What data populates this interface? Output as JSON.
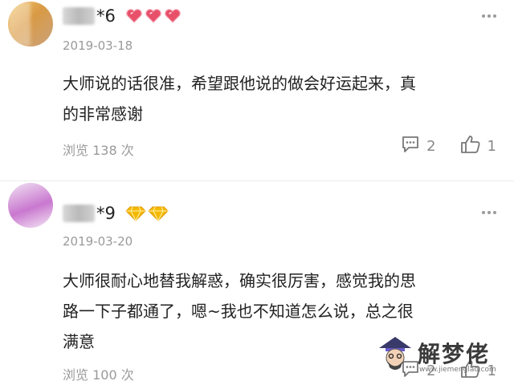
{
  "comments": [
    {
      "name_suffix": "*6",
      "badge_type": "heart",
      "badge_count": 3,
      "date": "2019-03-18",
      "text_line1": "大师说的话很准，希望跟他说的做会好运起来，真",
      "text_line2": "的非常感谢",
      "text_line3": "",
      "views": "浏览 138 次",
      "reply_count": "2",
      "like_count": "1"
    },
    {
      "name_suffix": "*9",
      "badge_type": "diamond",
      "badge_count": 2,
      "date": "2019-03-20",
      "text_line1": "大师很耐心地替我解惑，确实很厉害，感觉我的思",
      "text_line2": "路一下子都通了，嗯~我也不知道怎么说，总之很",
      "text_line3": "满意",
      "views": "浏览 100 次",
      "reply_count": "2",
      "like_count": "1"
    }
  ],
  "watermark": {
    "title": "解梦佬",
    "url": "www.jiemenglao.com"
  },
  "colors": {
    "heart": "#e8506a",
    "diamond": "#f5b800",
    "muted": "#9a9a9a"
  },
  "icons": [
    "avatar",
    "heart-badge-icon",
    "diamond-badge-icon",
    "more-icon",
    "comment-reply-icon",
    "thumbs-up-icon",
    "watermark-logo-icon"
  ]
}
